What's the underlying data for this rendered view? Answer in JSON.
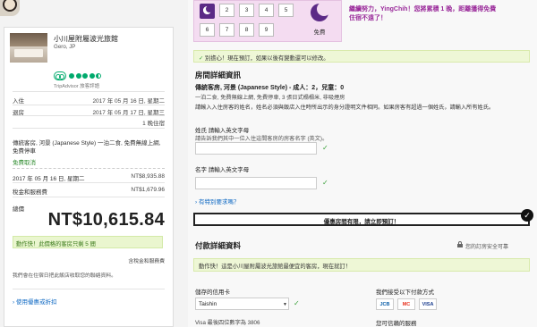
{
  "summary": {
    "hotel_name": "小川屋附屬波光旅館",
    "hotel_location": "Gero, JP",
    "tripadvisor_label": "TripAdvisor 旅客評語",
    "checkin_label": "入住",
    "checkin_date": "2017 年 05 月 16 日, 星期二",
    "checkout_label": "退房",
    "checkout_date": "2017 年 05 月 17 日, 星期三",
    "nights": "1 晚住宿",
    "room_desc": "傳統客房, 河景 (Japanese Style) 一泊二食, 免費無線上網, 免費停車",
    "free_cancel": "免費取消",
    "price_row_date": "2017 年 05 月 16 日, 星期二",
    "price_row_amount": "NT$8,935.88",
    "tax_label": "稅金和服務費",
    "tax_amount": "NT$1,679.96",
    "total_label": "總價",
    "total_price": "NT$10,615.84",
    "urgency_text": "動作快！此價格的客房只剩 5 間",
    "tax_included_link": "含稅金和服務費",
    "privacy_note": "我們會在住宿日把此飯店收取您的聯絡資料。",
    "promo_link": "使用優惠或折扣"
  },
  "stamp_card": {
    "stamps": [
      "2",
      "3",
      "4",
      "5",
      "6",
      "7",
      "8",
      "9"
    ],
    "free_label": "免費",
    "reward_line1": "繼續努力，YingChih！您將累積 1 晚，距離獲得免費",
    "reward_line2": "住宿不遠了！"
  },
  "notice": {
    "text": "別擔心！現在預訂，如果以後有變動還可以修改。"
  },
  "guest": {
    "title": "房間詳細資訊",
    "room_type_line": "傳統客房, 河景 (Japanese Style) - 成人：2，兒童：0",
    "room_type_sub": "一泊二食, 免費無線上網, 免費停車, 3 張日式榻榻米, 非吸煙房",
    "name_instruction": "請輸入入住房客的姓名，姓名必須與飯店入住時所出示的身分證明文件相同。如果房客有超過一個姓氏，請輸入所有姓氏。",
    "surname_label": "姓氏 請輸入英文字母",
    "surname_hint": "請告訴我們其中一位入住這間客房的房客名字 (英文)。",
    "surname_value": "",
    "given_label": "名字 請輸入英文字母",
    "given_hint": "",
    "given_value": "",
    "special_request": "有特別要求嗎？"
  },
  "confirm": {
    "text": "優惠房間有限，請立即預訂！"
  },
  "payment": {
    "title": "付款詳細資料",
    "secure_note": "您的訂房安全可靠",
    "notice": "動作快！這是小川屋附屬波光旅館最便宜的客房，現在就訂！",
    "card_label": "儲存的信用卡",
    "card_selected": "Taishin",
    "visa_last4": "Visa 最後四位數字為 3806",
    "methods_label": "我們接受以下付款方式",
    "method_logos": [
      "JCB",
      "MC",
      "VISA"
    ],
    "trusted_label": "您可信賴的服務"
  },
  "colors": {
    "accent_purple": "#5b2a86",
    "reward_pink": "#9a2a9a",
    "success_green": "#3aa03a",
    "link_blue": "#0a66c2",
    "notice_bg": "#eef7d6"
  }
}
